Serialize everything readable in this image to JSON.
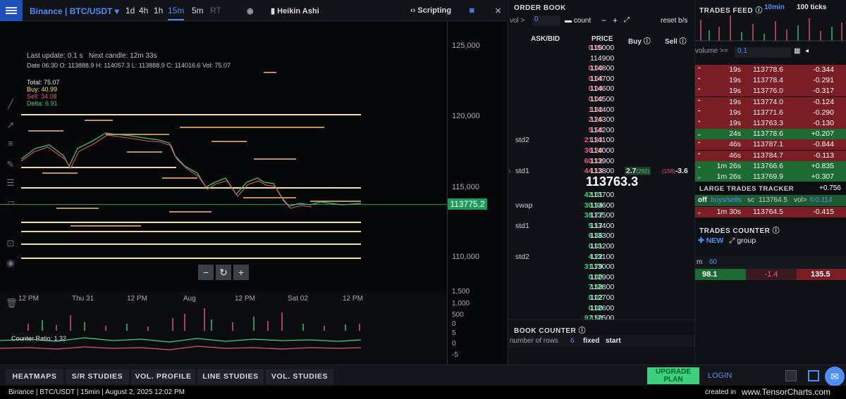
{
  "topbar": {
    "symbol": "Binance | BTC/USDT",
    "timeframes": [
      "1d",
      "4h",
      "1h",
      "15m",
      "5m",
      "RT"
    ],
    "active": "15m",
    "heikin": "Heikin Ashi",
    "scripting": "Scripting"
  },
  "info": {
    "last_update": "Last update: 0.1 s",
    "next_candle": "Next candle: 12m 33s",
    "ohlc": "Date 06:30 O: 113888.9 H: 114057.3 L: 113888.9 C: 114016.6 Vol: 75.07",
    "total": "Total: 75.07",
    "buy": "Buy: 40.99",
    "sell": "Sell: 34.08",
    "delta": "Delta: 6.91"
  },
  "yaxis": {
    "labels": [
      "125,000",
      "120,000",
      "115,000",
      "110,000"
    ],
    "price_tag": "113775.2",
    "vol_labels": [
      "1,500",
      "1,000",
      "500",
      "0"
    ],
    "osc_labels": [
      "5",
      "0",
      "-5"
    ]
  },
  "xaxis": {
    "labels": [
      "12 PM",
      "Thu 31",
      "12 PM",
      "Aug",
      "12 PM",
      "Sat 02",
      "12 PM"
    ]
  },
  "osc_label": "Counter Ratio: 1.32",
  "zoom": {
    "minus": "−",
    "reset": "↻",
    "plus": "+"
  },
  "orderbook": {
    "title": "ORDER BOOK",
    "vol_label": "vol >",
    "vol_value": "0",
    "count": "count",
    "minus": "−",
    "plus": "+",
    "reset": "reset b/s",
    "col_ask": "ASK/BID",
    "col_price": "PRICE",
    "col_buy": "Buy",
    "col_sell": "Sell",
    "mid_price": "113763.3",
    "asks": [
      {
        "v": "0.00",
        "p": "115000",
        "l": ""
      },
      {
        "v": "",
        "p": "114900",
        "l": ""
      },
      {
        "v": "0.00",
        "p": "114800",
        "l": ""
      },
      {
        "v": "0.04",
        "p": "114700",
        "l": ""
      },
      {
        "v": "0.04",
        "p": "114600",
        "l": ""
      },
      {
        "v": "0.00",
        "p": "114500",
        "l": ""
      },
      {
        "v": "1.82",
        "p": "114400",
        "l": ""
      },
      {
        "v": "2.26",
        "p": "114300",
        "l": ""
      },
      {
        "v": "5.58",
        "p": "114200",
        "l": ""
      },
      {
        "v": "21.93",
        "p": "114100",
        "l": "std2"
      },
      {
        "v": "36.28",
        "p": "114000",
        "l": ""
      },
      {
        "v": "60.12",
        "p": "113900",
        "l": ""
      },
      {
        "v": "44.13",
        "p": "113800",
        "l": "std1"
      }
    ],
    "row_buy": "2.7",
    "row_buy_n": "(292)",
    "row_sell_n": "(158)",
    "row_sell": "-3.6",
    "bids": [
      {
        "v": "42.01",
        "p": "113700",
        "l": ""
      },
      {
        "v": "30.94",
        "p": "113600",
        "l": "vwap"
      },
      {
        "v": "38.77",
        "p": "113500",
        "l": ""
      },
      {
        "v": "5.17",
        "p": "113400",
        "l": "std1"
      },
      {
        "v": "6.36",
        "p": "113300",
        "l": ""
      },
      {
        "v": "0.01",
        "p": "113200",
        "l": ""
      },
      {
        "v": "4.22",
        "p": "113100",
        "l": "std2"
      },
      {
        "v": "31.79",
        "p": "113000",
        "l": ""
      },
      {
        "v": "0.00",
        "p": "112900",
        "l": ""
      },
      {
        "v": "7.59",
        "p": "112800",
        "l": ""
      },
      {
        "v": "0.02",
        "p": "112700",
        "l": ""
      },
      {
        "v": "0.00",
        "p": "112600",
        "l": ""
      },
      {
        "v": "97.50",
        "p": "112500",
        "l": ""
      }
    ]
  },
  "bookcounter": {
    "title": "BOOK COUNTER",
    "rows_label": "number of rows",
    "rows_value": "6",
    "fixed": "fixed",
    "start": "start"
  },
  "trades": {
    "title": "TRADES FEED",
    "opt1": "10min",
    "opt2": "100 ticks",
    "volume_label": "volume >=",
    "volume_value": "0.1",
    "rows": [
      {
        "t": "19s",
        "p": "113778.6",
        "d": "-0.344",
        "c": "r"
      },
      {
        "t": "19s",
        "p": "113778.4",
        "d": "-0.291",
        "c": "r"
      },
      {
        "t": "19s",
        "p": "113776.0",
        "d": "-0.317",
        "c": "r"
      },
      {
        "t": "19s",
        "p": "113774.0",
        "d": "-0.124",
        "c": "r"
      },
      {
        "t": "19s",
        "p": "113771.6",
        "d": "-0.290",
        "c": "r"
      },
      {
        "t": "19s",
        "p": "113763.3",
        "d": "-0.130",
        "c": "r"
      },
      {
        "t": "24s",
        "p": "113778.6",
        "d": "+0.207",
        "c": "g"
      },
      {
        "t": "46s",
        "p": "113787.1",
        "d": "-0.844",
        "c": "r"
      },
      {
        "t": "46s",
        "p": "113784.7",
        "d": "-0.113",
        "c": "r"
      },
      {
        "t": "1m 26s",
        "p": "113766.6",
        "d": "+0.835",
        "c": "g"
      },
      {
        "t": "1m 26s",
        "p": "113769.9",
        "d": "+0.307",
        "c": "g"
      }
    ],
    "extra_delta": "+0.756",
    "large_title": "LARGE TRADES TRACKER",
    "off": "off",
    "sells": "buys/sells",
    "scale": "sc",
    "vol_short": "vol>",
    "large_row": {
      "t": "1m 30s",
      "p": "113764.5",
      "d": "-0.415"
    },
    "large_val": "0.114"
  },
  "counter": {
    "title": "TRADES COUNTER",
    "new": "NEW",
    "group": "group",
    "m": "m",
    "m_val": "60",
    "v1": "98.1",
    "v2": "-1.4",
    "v3": "135.5"
  },
  "bottom": {
    "tabs": [
      "HEATMAPS",
      "S/R STUDIES",
      "VOL. PROFILE",
      "LINE STUDIES",
      "VOL. STUDIES"
    ],
    "upgrade": "UPGRADE PLAN",
    "login": "LOGIN"
  },
  "status": {
    "left": "Binance | BTC/USDT | 15min | August 2, 2025 12:02 PM",
    "created": "created in",
    "brand": "www.TensorCharts.com"
  }
}
